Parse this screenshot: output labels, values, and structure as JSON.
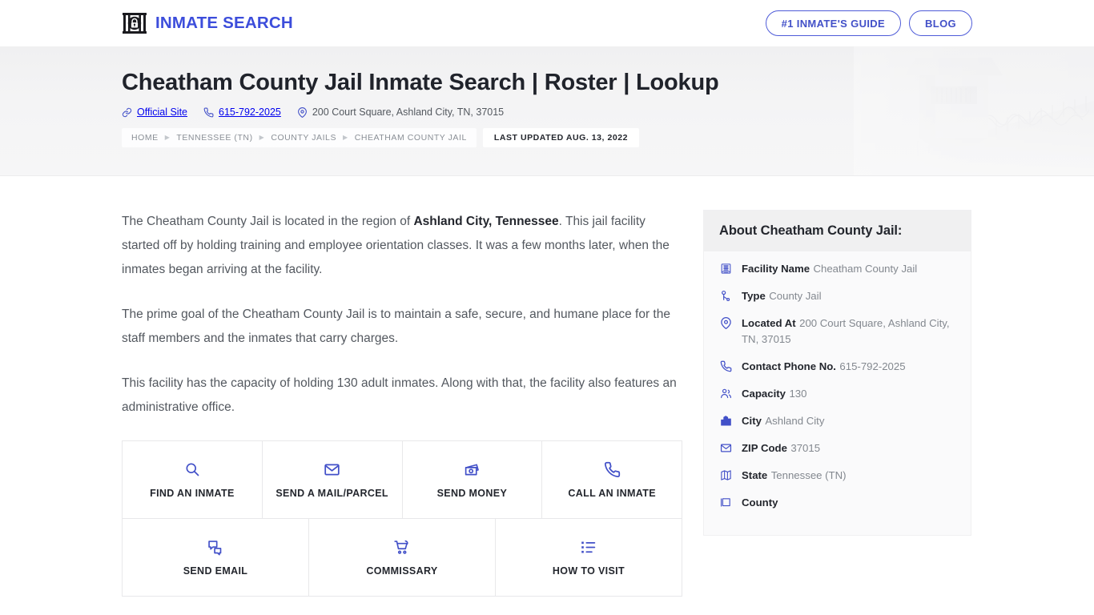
{
  "brand": {
    "name": "INMATE SEARCH",
    "logo_icon": "jail-bars-padlock-icon"
  },
  "nav": {
    "buttons": [
      {
        "label": "#1 INMATE'S GUIDE",
        "name": "inmates-guide-button"
      },
      {
        "label": "BLOG",
        "name": "blog-button"
      }
    ]
  },
  "hero": {
    "title": "Cheatham County Jail Inmate Search | Roster | Lookup",
    "meta": [
      {
        "icon": "link-icon",
        "label": "Official Site"
      },
      {
        "icon": "phone-icon",
        "label": "615-792-2025"
      },
      {
        "icon": "map-pin-icon",
        "label": "200 Court Square, Ashland City, TN, 37015"
      }
    ],
    "breadcrumbs": [
      "HOME",
      "TENNESSEE (TN)",
      "COUNTY JAILS",
      "CHEATHAM COUNTY JAIL"
    ],
    "last_updated": "LAST UPDATED AUG. 13, 2022",
    "artwork": "prison-watchtower-fence-photo"
  },
  "content": {
    "paragraphs": [
      {
        "pre": "The Cheatham County Jail is located in the region of ",
        "bold": "Ashland City, Tennessee",
        "post": ". This jail facility started off by holding training and employee orientation classes. It was a few months later, when the inmates began arriving at the facility."
      },
      {
        "pre": "The prime goal of the Cheatham County Jail is to maintain a safe, secure, and humane place for the staff members and the inmates that carry charges.",
        "bold": "",
        "post": ""
      },
      {
        "pre": "This facility has the capacity of holding 130 adult inmates. Along with that, the facility also features an administrative office.",
        "bold": "",
        "post": ""
      }
    ]
  },
  "tiles": [
    {
      "label": "FIND AN INMATE",
      "icon": "search-icon",
      "name": "tile-find-an-inmate"
    },
    {
      "label": "SEND A MAIL/PARCEL",
      "icon": "envelope-icon",
      "name": "tile-send-a-mail-parcel"
    },
    {
      "label": "SEND MONEY",
      "icon": "money-icon",
      "name": "tile-send-money"
    },
    {
      "label": "CALL AN INMATE",
      "icon": "phone-icon",
      "name": "tile-call-an-inmate"
    },
    {
      "label": "SEND EMAIL",
      "icon": "chat-bubbles-icon",
      "name": "tile-send-email"
    },
    {
      "label": "COMMISSARY",
      "icon": "shopping-cart-icon",
      "name": "tile-commissary"
    },
    {
      "label": "HOW TO VISIT",
      "icon": "list-icon",
      "name": "tile-how-to-visit"
    }
  ],
  "sidebar": {
    "title": "About Cheatham County Jail:",
    "items": [
      {
        "icon": "building-grid-icon",
        "label": "Facility Name",
        "value": "Cheatham County Jail"
      },
      {
        "icon": "key-icon",
        "label": "Type",
        "value": "County Jail"
      },
      {
        "icon": "map-pin-icon",
        "label": "Located At",
        "value": "200 Court Square, Ashland City, TN, 37015"
      },
      {
        "icon": "phone-icon",
        "label": "Contact Phone No.",
        "value": "615-792-2025"
      },
      {
        "icon": "users-icon",
        "label": "Capacity",
        "value": "130"
      },
      {
        "icon": "city-icon",
        "label": "City",
        "value": "Ashland City"
      },
      {
        "icon": "envelope-icon",
        "label": "ZIP Code",
        "value": "37015"
      },
      {
        "icon": "map-icon",
        "label": "State",
        "value": "Tennessee (TN)"
      },
      {
        "icon": "county-icon",
        "label": "County",
        "value": ""
      }
    ]
  },
  "colors": {
    "accent": "#4250c8",
    "brand": "#3c4ddb",
    "text_dark": "#23262d",
    "text_muted": "#83888f",
    "panel_bg": "#fafafb",
    "panel_head": "#f0f0f1",
    "hero_bg": "#f4f4f5",
    "border": "#e8e8ea"
  }
}
